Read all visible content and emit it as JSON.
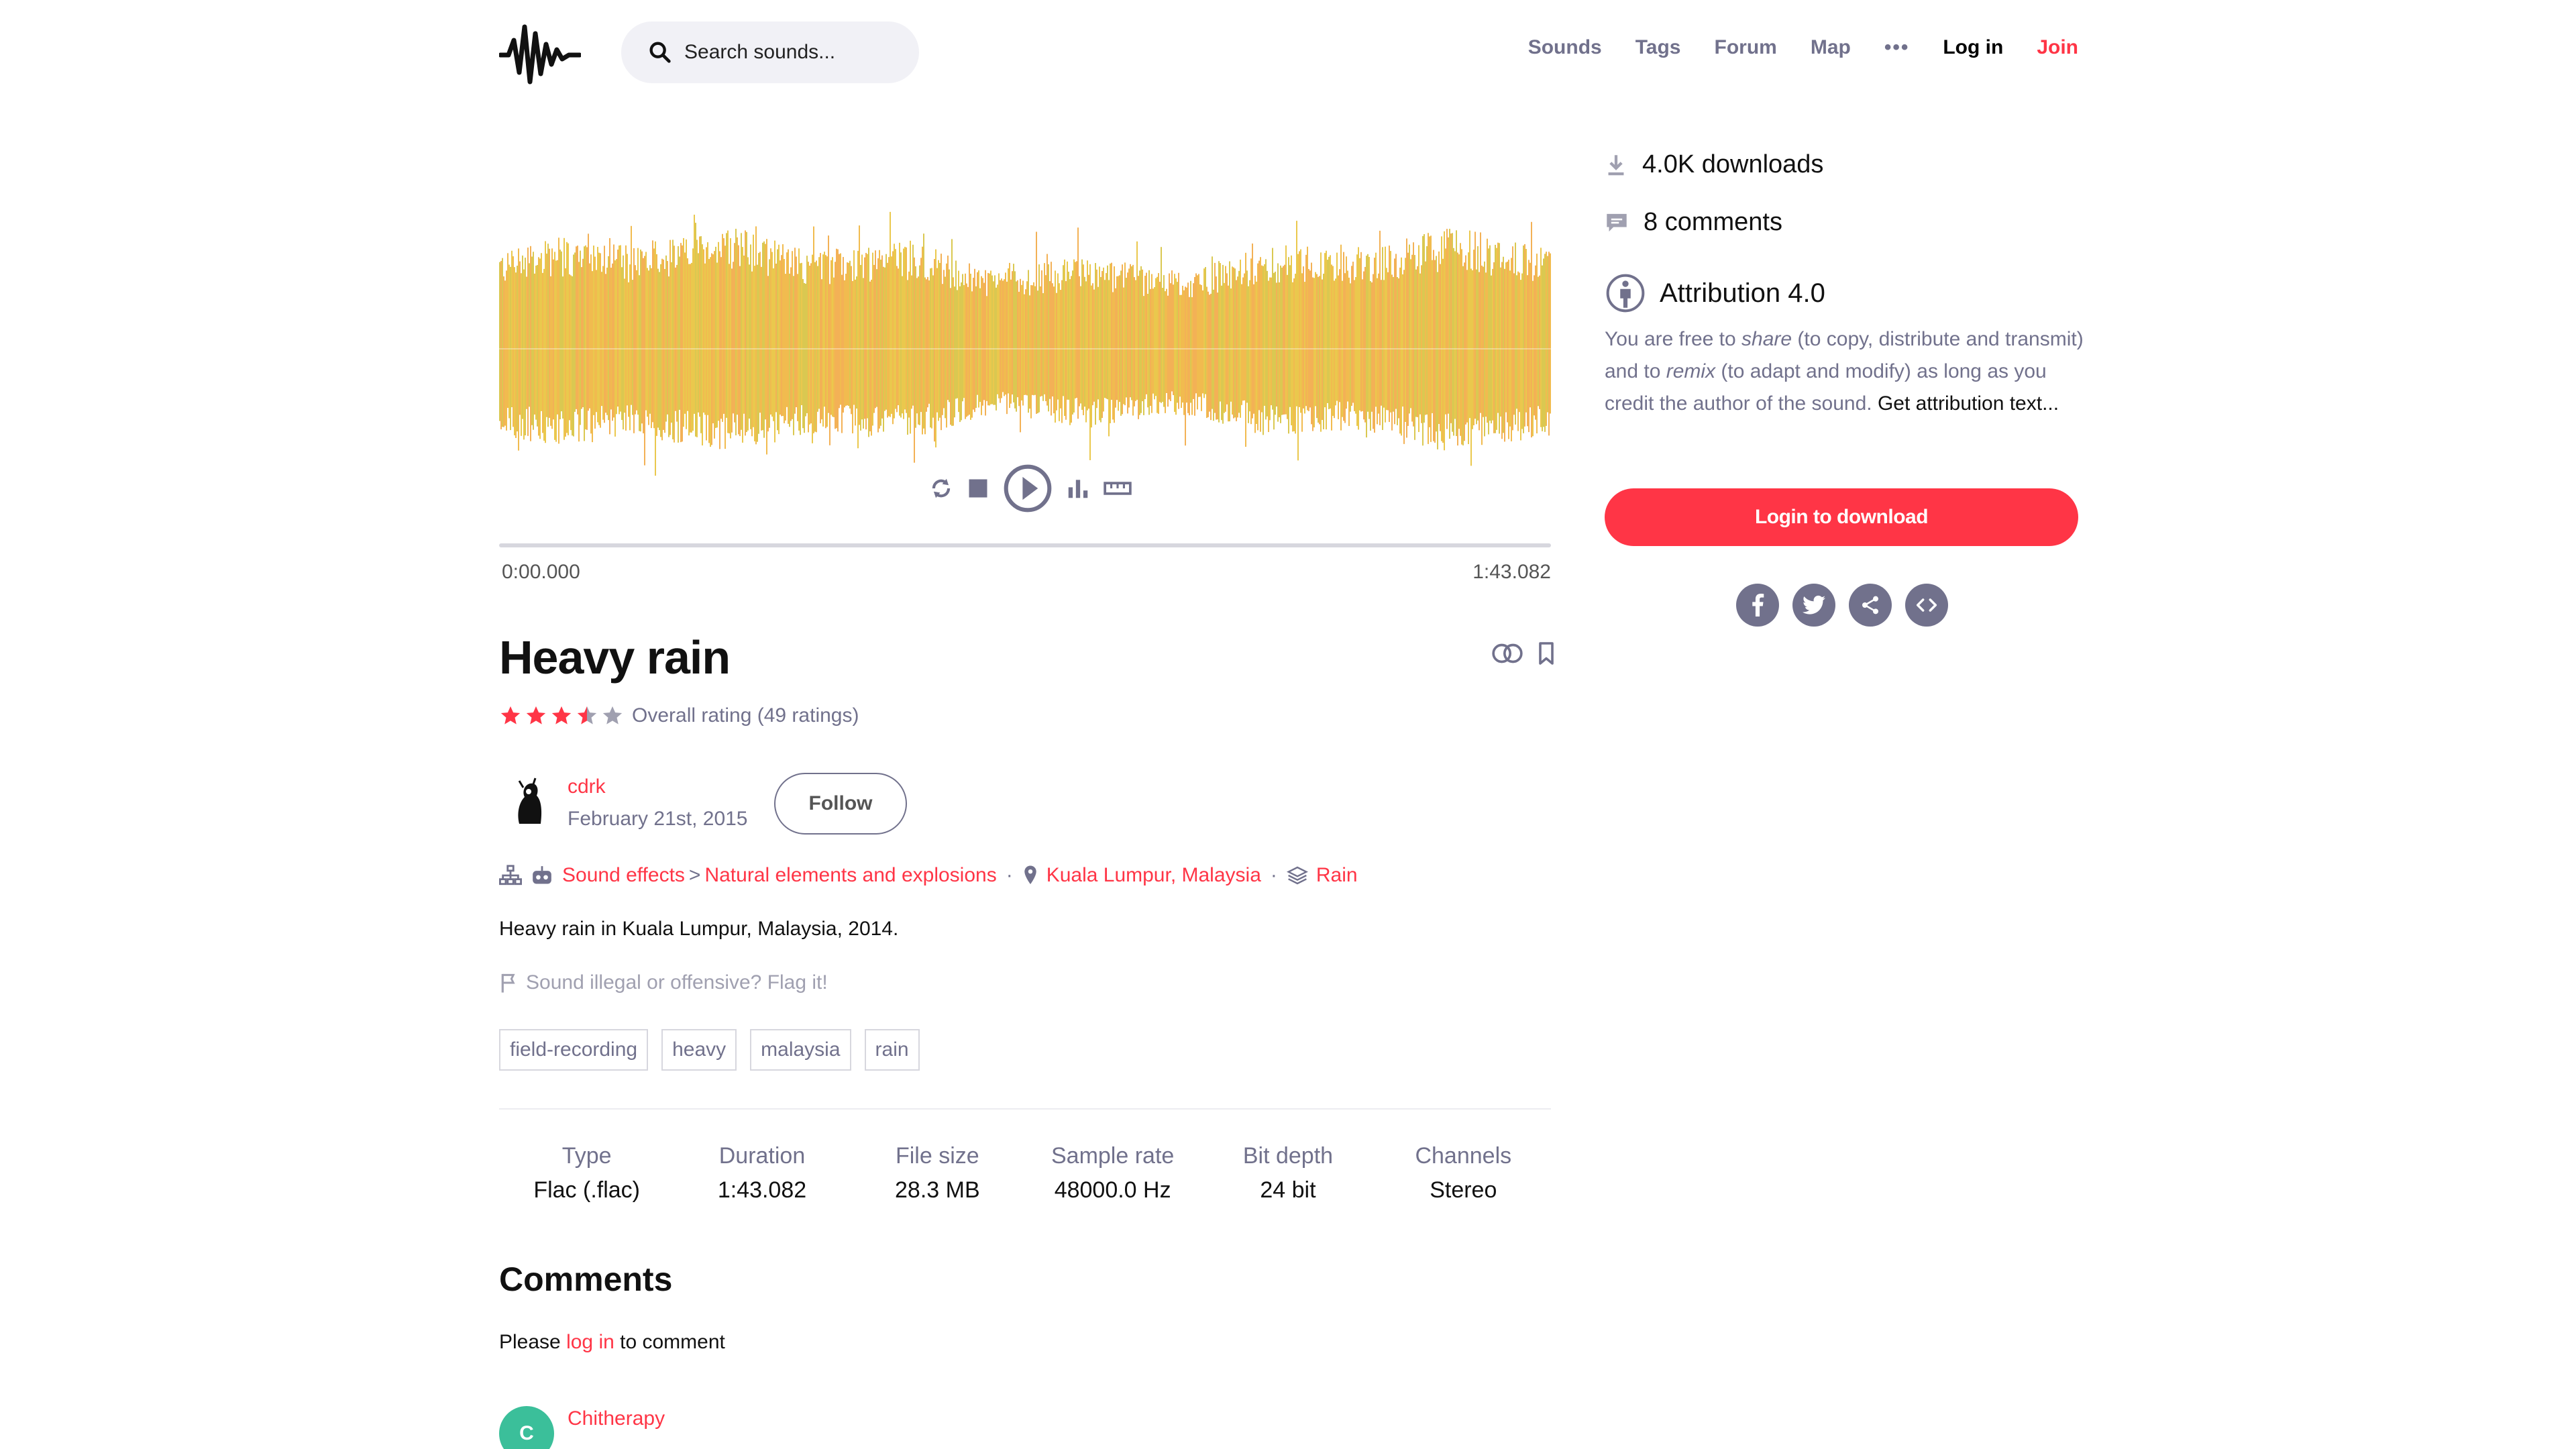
{
  "header": {
    "search_placeholder": "Search sounds...",
    "nav": [
      "Sounds",
      "Tags",
      "Forum",
      "Map"
    ],
    "more": "•••",
    "login": "Log in",
    "join": "Join"
  },
  "player": {
    "time_start": "0:00.000",
    "time_end": "1:43.082",
    "waveform_colors": [
      "#e8c23a",
      "#f0b43c",
      "#d6c23e",
      "#f2a844"
    ]
  },
  "sound": {
    "title": "Heavy rain",
    "rating": 3.5,
    "rating_text": "Overall rating (49 ratings)",
    "author": "cdrk",
    "date": "February 21st, 2015",
    "follow": "Follow",
    "category_1": "Sound effects",
    "category_sep": ">",
    "category_2": "Natural elements and explosions",
    "location": "Kuala Lumpur, Malaysia",
    "pack": "Rain",
    "description": "Heavy rain in Kuala Lumpur, Malaysia, 2014.",
    "flag": "Sound illegal or offensive? Flag it!",
    "tags": [
      "field-recording",
      "heavy",
      "malaysia",
      "rain"
    ]
  },
  "meta": [
    {
      "label": "Type",
      "value": "Flac (.flac)"
    },
    {
      "label": "Duration",
      "value": "1:43.082"
    },
    {
      "label": "File size",
      "value": "28.3 MB"
    },
    {
      "label": "Sample rate",
      "value": "48000.0 Hz"
    },
    {
      "label": "Bit depth",
      "value": "24 bit"
    },
    {
      "label": "Channels",
      "value": "Stereo"
    }
  ],
  "comments": {
    "heading": "Comments",
    "please": "Please",
    "login_link": "log in",
    "to_comment": "to comment",
    "first_initial": "C",
    "first_author": "Chitherapy"
  },
  "sidebar": {
    "downloads": "4.0K downloads",
    "comments": "8 comments",
    "license": "Attribution 4.0",
    "license_p1": "You are free to ",
    "license_share": "share",
    "license_p2": " (to copy, distribute and transmit) and to ",
    "license_remix": "remix",
    "license_p3": " (to adapt and modify) as long as you credit the author of the sound. ",
    "license_get": "Get attribution text...",
    "download_btn": "Login to download"
  },
  "colors": {
    "accent": "#ff3546",
    "muted": "#71718c"
  }
}
